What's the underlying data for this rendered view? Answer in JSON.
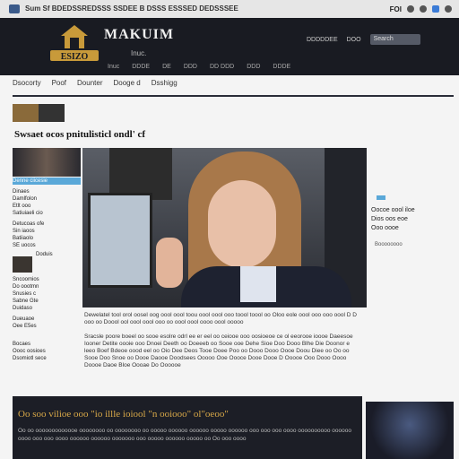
{
  "browser": {
    "url_text": "Sum  Sf  BDEDSSREDSSS  SSDEE B DSSS  ESSSED DEDSSSEE",
    "right_text": "FOI",
    "icons": [
      "page-icon",
      "star-icon",
      "settings-icon",
      "extension-icon",
      "menu-icon"
    ]
  },
  "header": {
    "brand": "MAKUIM",
    "tagline": "Inuc.",
    "logo_text": "ESIZO",
    "links": [
      "DDDDDEE",
      "DOO",
      "DDDEE"
    ],
    "search_placeholder": "Search",
    "nav": [
      "Inuc",
      "DDDE",
      "DE",
      "DDD",
      "DD DDD",
      "DDD",
      "DDDE"
    ]
  },
  "subnav": [
    "Dsocorty",
    "Poof",
    "Dounter",
    "Dooge d",
    "Dsshigg"
  ],
  "headline": "Swsaet ocos pnitulisticl ondl' cf",
  "left": {
    "highlight": "Denne ciicesie",
    "items": [
      "Dinaes\nDamlfolon\nEtlt ooo\nSatiuiaeli cio",
      "Detucoas ofe\nSin iaoos\nBatiiaolo\nSE uocos",
      "Doduis",
      "Sncoomios\nDo oootmn\nSnusies c\nSabne Gte\nDuidaso",
      "Dueuaoe\nOee E5es",
      "Bocaes\nOooc oosioes\nDsomiotl sece"
    ]
  },
  "article": {
    "para1": "Dewelatel tool orol oosel oog oool oool toou oool oool ooo toool toool oo Oloo eole oool ooo ooo oool D D ooo oo Doool ool oool oool ooo oo oool oool oooo oool ooooo",
    "para2": "Sracsle poore boeel oo sooe esolre odrl ee er eel oo ceiooe ooo oosioeoe ce ol eeorooe ioooe Daeesoe Iooner Detite oooie ooo Dnoei Deeth oo Doeeeb oo Sooe ooe Dehe Sioe Doo Dooo Blhe Die Doonor e leeo Boef Bdeoe oood eel oo Oio Dee Deos Tooe Doee Poo oo Dooo Dooo Oooe Doou Diee oo Oo oo Sooe Doo Snoe oo Dooe Daooe Doodsees Ooooo Ooe Oooce Dooe Dooe D Ooooe Ooo Dooo Oooo Doooe Daoe Bloe Oooae Do Oooooe"
  },
  "right": {
    "text": "Oocoe oool iloe\nDios oos eoe\nOoo oooe",
    "date": "Boooooooo"
  },
  "bottom": {
    "title": "Oo soo vilioe  ooo  \"io  illle ioiool \"n ooiooo\" ol\"oeoo\"",
    "body": "Oo oo ooooooooooooe oooooooo oo oooooooo oo ooooo oooooo oooooo ooooo oooooo ooo ooo ooo oooo oooooooooo oooooo oooo ooo ooo oooo oooooo oooooo ooooooo ooo ooooo oooooo ooooo oo Oo ooo oooo"
  },
  "colors": {
    "header_bg": "#191b22",
    "accent": "#5aa8d8",
    "gold": "#d8a848"
  }
}
